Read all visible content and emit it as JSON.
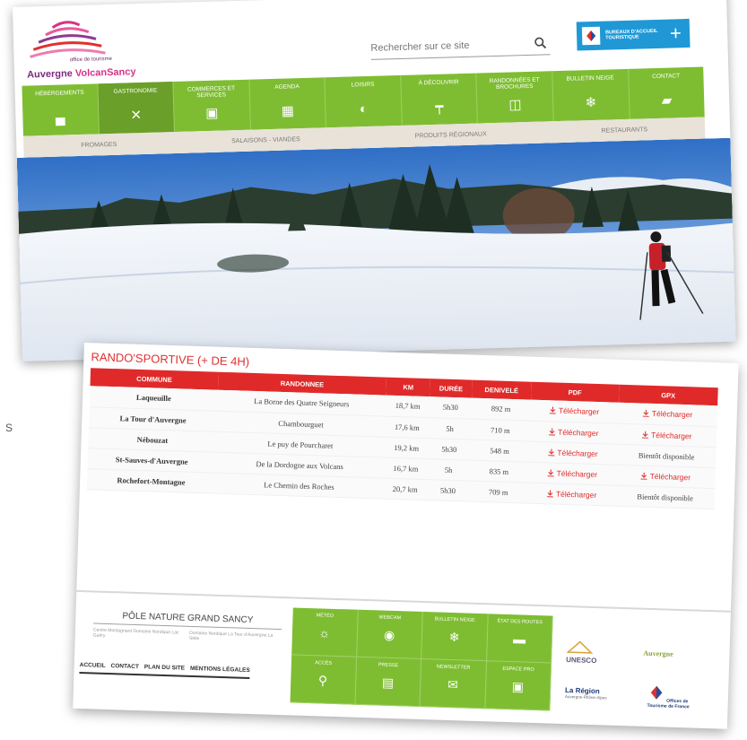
{
  "left_glyph": "S",
  "site": {
    "logo_small": "office de tourisme",
    "logo_name_a": "Auvergne ",
    "logo_name_b": "VolcanSancy"
  },
  "search": {
    "placeholder": "Rechercher sur ce site"
  },
  "bureau": {
    "text": "BUREAUX D'ACCUEIL TOURISTIQUE",
    "plus": "+"
  },
  "nav": {
    "items": [
      {
        "label": "HÉBERGEMENTS",
        "icon": "bed-icon",
        "glyph": "▄"
      },
      {
        "label": "GASTRONOMIE",
        "icon": "cutlery-icon",
        "glyph": "✕"
      },
      {
        "label": "COMMERCES ET SERVICES",
        "icon": "shop-icon",
        "glyph": "▣"
      },
      {
        "label": "AGENDA",
        "icon": "calendar-icon",
        "glyph": "▦"
      },
      {
        "label": "LOISIRS",
        "icon": "ball-icon",
        "glyph": "◐"
      },
      {
        "label": "À DÉCOUVRIR",
        "icon": "signpost-icon",
        "glyph": "┯"
      },
      {
        "label": "RANDONNÉES ET BROCHURES",
        "icon": "map-icon",
        "glyph": "◫"
      },
      {
        "label": "BULLETIN NEIGE",
        "icon": "snowflake-icon",
        "glyph": "❄"
      },
      {
        "label": "CONTACT",
        "icon": "chat-icon",
        "glyph": "▰"
      }
    ]
  },
  "subnav": [
    "FROMAGES",
    "SALAISONS - VIANDES",
    "PRODUITS RÉGIONAUX",
    "RESTAURANTS"
  ],
  "rando": {
    "title": "RANDO'SPORTIVE (+ DE 4H)",
    "headers": [
      "COMMUNE",
      "RANDONNEE",
      "KM",
      "DURÉE",
      "DENIVELÉ",
      "PDF",
      "GPX"
    ],
    "rows": [
      {
        "commune": "Laqueuille",
        "rando": "La Borne des Quatre Seigneurs",
        "km": "18,7 km",
        "duree": "5h30",
        "deniv": "892 m",
        "pdf": "Télécharger",
        "gpx": "Télécharger"
      },
      {
        "commune": "La Tour d'Auvergne",
        "rando": "Chambourguet",
        "km": "17,6 km",
        "duree": "5h",
        "deniv": "710 m",
        "pdf": "Télécharger",
        "gpx": "Télécharger"
      },
      {
        "commune": "Nébouzat",
        "rando": "Le puy de Pourcharet",
        "km": "19,2 km",
        "duree": "5h30",
        "deniv": "548 m",
        "pdf": "Télécharger",
        "gpx": "Bientôt disponible"
      },
      {
        "commune": "St-Sauves-d'Auvergne",
        "rando": "De la Dordogne aux Volcans",
        "km": "16,7 km",
        "duree": "5h",
        "deniv": "835 m",
        "pdf": "Télécharger",
        "gpx": "Télécharger"
      },
      {
        "commune": "Rochefort-Montagne",
        "rando": "Le Chemin des Roches",
        "km": "20,7 km",
        "duree": "5h30",
        "deniv": "709 m",
        "pdf": "Télécharger",
        "gpx": "Bientôt disponible"
      }
    ]
  },
  "footer": {
    "pole_title": "PÔLE NATURE GRAND SANCY",
    "pole_left": "Centre Montagnard Domaine Nordique Lac Guéry",
    "pole_right": "Domaine Nordique La Tour d'Auvergne La Stèle",
    "links": [
      "ACCUEIL",
      "CONTACT",
      "PLAN DU SITE",
      "MENTIONS LÉGALES"
    ],
    "grid": [
      {
        "label": "MÉTÉO",
        "glyph": "☼",
        "icon": "sun-icon"
      },
      {
        "label": "WEBCAM",
        "glyph": "◉",
        "icon": "webcam-icon"
      },
      {
        "label": "BULLETIN NEIGE",
        "glyph": "❄",
        "icon": "snowflake-icon"
      },
      {
        "label": "ÉTAT DES ROUTES",
        "glyph": "▬",
        "icon": "car-icon"
      },
      {
        "label": "ACCÈS",
        "glyph": "⚲",
        "icon": "access-icon"
      },
      {
        "label": "PRESSE",
        "glyph": "▤",
        "icon": "press-icon"
      },
      {
        "label": "NEWSLETTER",
        "glyph": "✉",
        "icon": "mail-icon"
      },
      {
        "label": "ESPACE PRO",
        "glyph": "▣",
        "icon": "lock-icon"
      }
    ],
    "partners": {
      "unesco": "UNESCO",
      "auvergne": "Auvergne",
      "region": "La Région",
      "region_sub": "Auvergne-Rhône-Alpes",
      "france": "Offices de Tourisme de France"
    }
  }
}
